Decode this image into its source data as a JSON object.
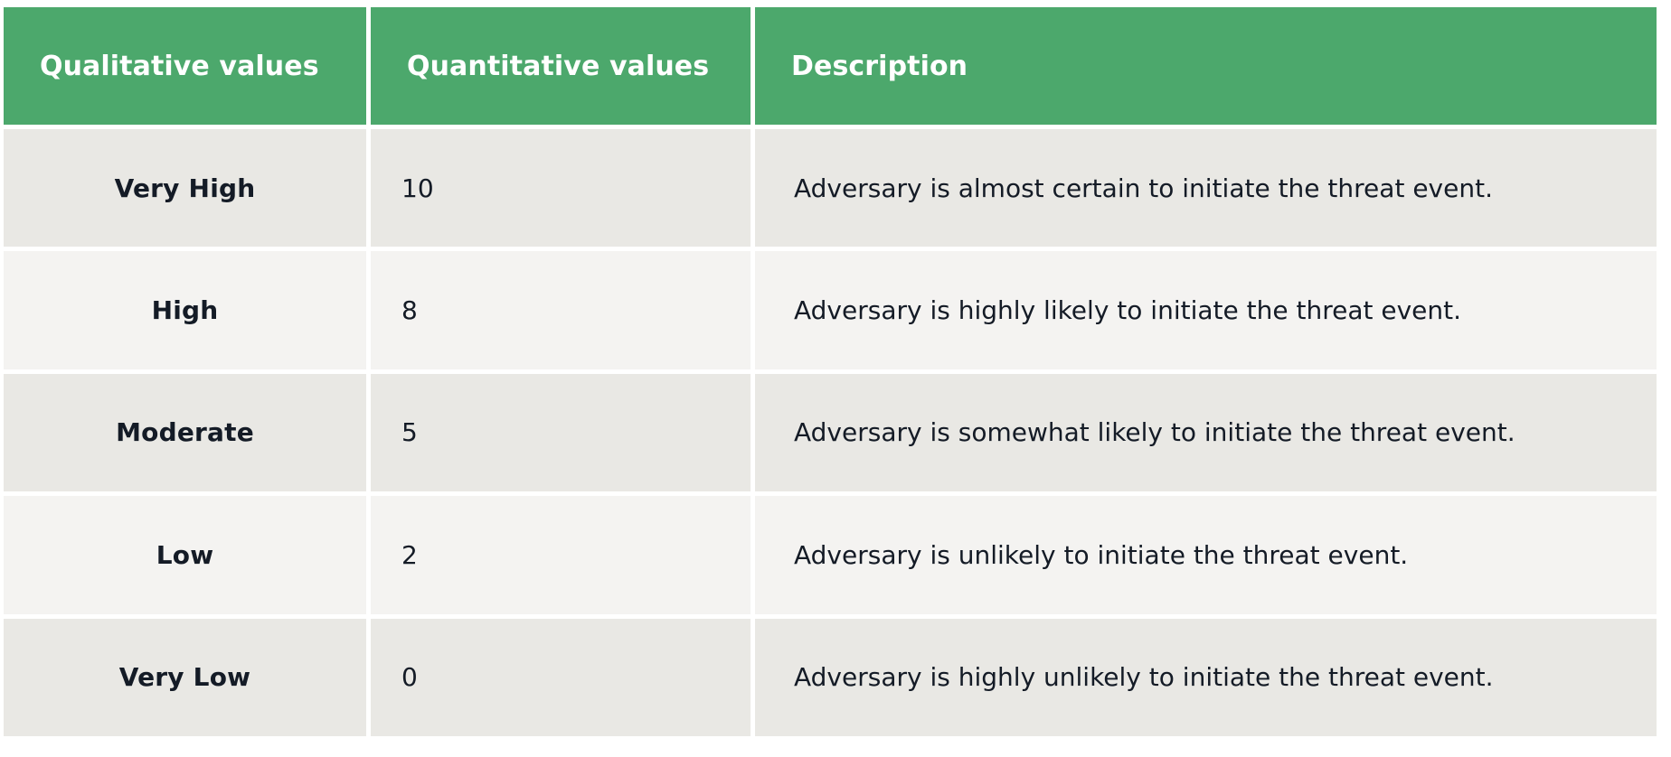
{
  "table": {
    "name": "threat-likelihood-assessment-scale",
    "colors": {
      "header_bg": "#4ca86c",
      "header_text": "#ffffff",
      "row_odd_bg": "#e9e8e4",
      "row_even_bg": "#f4f3f1",
      "body_text": "#141b26",
      "page_bg": "#ffffff"
    },
    "columns": [
      {
        "key": "qualitative",
        "label": "Qualitative values",
        "align": "center"
      },
      {
        "key": "quantitative",
        "label": "Quantitative values",
        "align": "left"
      },
      {
        "key": "description",
        "label": "Description",
        "align": "left"
      }
    ],
    "rows": [
      {
        "qualitative": "Very High",
        "quantitative": "10",
        "description": "Adversary is almost certain to initiate the threat event."
      },
      {
        "qualitative": "High",
        "quantitative": "8",
        "description": "Adversary is highly likely to initiate the threat event."
      },
      {
        "qualitative": "Moderate",
        "quantitative": "5",
        "description": "Adversary is somewhat likely to initiate the threat event."
      },
      {
        "qualitative": "Low",
        "quantitative": "2",
        "description": "Adversary is unlikely to initiate the threat event."
      },
      {
        "qualitative": "Very Low",
        "quantitative": "0",
        "description": "Adversary is highly unlikely to initiate the threat event."
      }
    ]
  }
}
